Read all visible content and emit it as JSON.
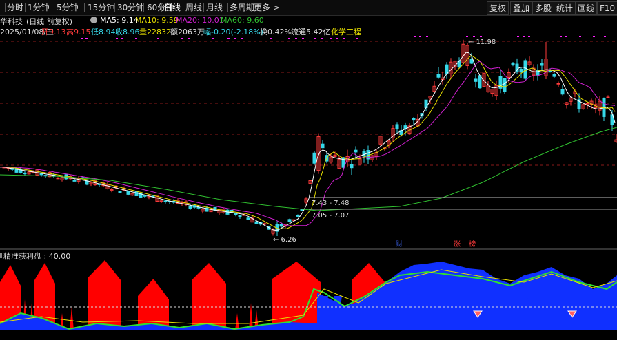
{
  "toolbar": {
    "items": [
      "分时",
      "1分钟",
      "5分钟",
      "15分钟",
      "30分钟",
      "60分钟",
      "日线",
      "周线",
      "月线",
      "多周期",
      "更多 >"
    ],
    "active": "日线",
    "right_items": [
      "复权",
      "叠加",
      "多股",
      "统计",
      "画线",
      "F10"
    ]
  },
  "info": {
    "stock_name": "华科技",
    "period_label": "(日线 前复权)",
    "ma5": "MA5: 9.14",
    "ma10": "MA10: 9.59",
    "ma20": "MA20: 10.01",
    "ma60": "MA60: 9.60"
  },
  "quote": {
    "date": "2025/01/08/三",
    "open": "开9.13",
    "high": "高9.15",
    "low": "低8.94",
    "close": "收8.96",
    "volume": "量22832",
    "amount": "额2063万",
    "change": "幅-0.20(-2.18%)",
    "turnover": "换0.42%",
    "float_cap": "流通5.42亿",
    "sector": "化学工程"
  },
  "price_annotations": {
    "high": "11.98",
    "low": "6.26",
    "range1": "7.43 - 7.48",
    "range2": "7.05 - 7.07"
  },
  "markers": [
    "财",
    "涨",
    "榜"
  ],
  "indicator": {
    "title": "精准获利盘 : 40.00",
    "value": 40.0
  },
  "colors": {
    "up": "#ff3b3b",
    "down": "#36d8e8",
    "ma5": "#ffffff",
    "ma10": "#e8e000",
    "ma20": "#d020d0",
    "ma60": "#30c030",
    "red_area": "#ff0000",
    "blue_area": "#1030ff",
    "grid": "#8a1a1a"
  }
}
